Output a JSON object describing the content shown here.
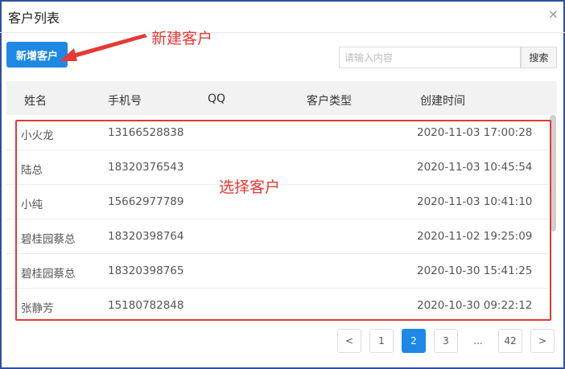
{
  "dialog": {
    "title": "客户列表",
    "close": "×"
  },
  "toolbar": {
    "add_label": "新增客户",
    "search_placeholder": "请输入内容",
    "search_label": "搜索"
  },
  "annotations": {
    "new_customer": "新建客户",
    "select_customer": "选择客户"
  },
  "table": {
    "columns": [
      "姓名",
      "手机号",
      "QQ",
      "客户类型",
      "创建时间"
    ],
    "rows": [
      {
        "name": "小火龙",
        "phone": "13166528838",
        "qq": "",
        "type": "",
        "created": "2020-11-03 17:00:28"
      },
      {
        "name": "陆总",
        "phone": "18320376543",
        "qq": "",
        "type": "",
        "created": "2020-11-03 10:45:54"
      },
      {
        "name": "小纯",
        "phone": "15662977789",
        "qq": "",
        "type": "",
        "created": "2020-11-03 10:41:10"
      },
      {
        "name": "碧桂园蔡总",
        "phone": "18320398764",
        "qq": "",
        "type": "",
        "created": "2020-11-02 19:25:09"
      },
      {
        "name": "碧桂园蔡总",
        "phone": "18320398765",
        "qq": "",
        "type": "",
        "created": "2020-10-30 15:41:25"
      },
      {
        "name": "张静芳",
        "phone": "15180782848",
        "qq": "",
        "type": "",
        "created": "2020-10-30 09:22:12"
      }
    ]
  },
  "pagination": {
    "prev": "<",
    "pages": [
      "1",
      "2",
      "3",
      "...",
      "42"
    ],
    "current": "2",
    "next": ">"
  },
  "colors": {
    "accent": "#1e88e5",
    "annotation": "#e53935"
  }
}
